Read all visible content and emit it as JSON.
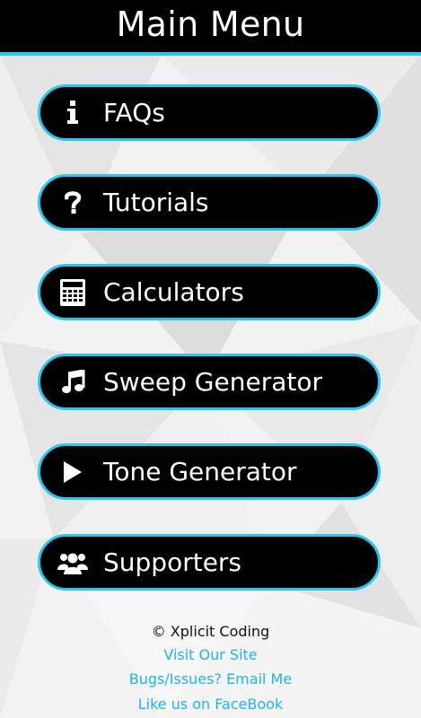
{
  "header": {
    "title": "Main Menu"
  },
  "menu": {
    "items": [
      {
        "label": "FAQs",
        "icon": "info-icon"
      },
      {
        "label": "Tutorials",
        "icon": "question-icon"
      },
      {
        "label": "Calculators",
        "icon": "calculator-icon"
      },
      {
        "label": "Sweep Generator",
        "icon": "music-note-icon"
      },
      {
        "label": "Tone Generator",
        "icon": "play-icon"
      },
      {
        "label": "Supporters",
        "icon": "users-icon"
      }
    ]
  },
  "footer": {
    "copyright": "© Xplicit Coding",
    "links": [
      "Visit Our Site",
      "Bugs/Issues? Email Me",
      "Like us on FaceBook"
    ]
  },
  "colors": {
    "accent": "#29c6f0",
    "link": "#1eb5e6",
    "button_bg": "#000000",
    "header_bg": "#000000"
  }
}
